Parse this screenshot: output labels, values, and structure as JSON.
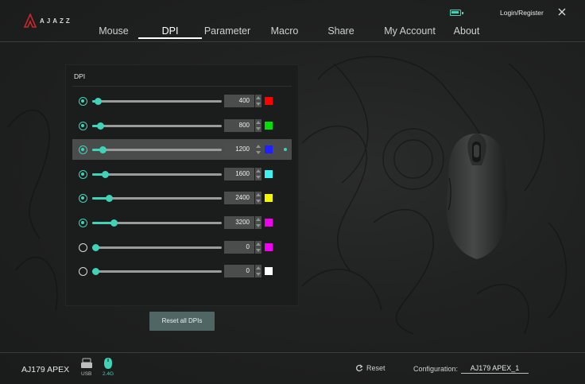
{
  "app": {
    "brand": "AJAZZ"
  },
  "header": {
    "nav": [
      {
        "label": "Mouse",
        "active": false
      },
      {
        "label": "DPI",
        "active": true
      },
      {
        "label": "Parameter",
        "active": false
      },
      {
        "label": "Macro",
        "active": false
      },
      {
        "label": "Share",
        "active": false
      },
      {
        "label": "My Account",
        "active": false
      },
      {
        "label": "About",
        "active": false
      }
    ],
    "login_label": "Login/Register",
    "battery_icon": "battery-icon",
    "close_icon": "close-icon"
  },
  "dpi_panel": {
    "title": "DPI",
    "levels": [
      {
        "value": "400",
        "color": "#ff0000",
        "checked": true,
        "fraction": 0.018
      },
      {
        "value": "800",
        "color": "#00e000",
        "checked": true,
        "fraction": 0.036
      },
      {
        "value": "1200",
        "color": "#1f1fff",
        "checked": true,
        "fraction": 0.054,
        "selected": true
      },
      {
        "value": "1600",
        "color": "#3ff0f0",
        "checked": true,
        "fraction": 0.071
      },
      {
        "value": "2400",
        "color": "#f5f500",
        "checked": true,
        "fraction": 0.107
      },
      {
        "value": "3200",
        "color": "#f000f0",
        "checked": true,
        "fraction": 0.143
      },
      {
        "value": "0",
        "color": "#f000f0",
        "checked": false,
        "fraction": 0.0
      },
      {
        "value": "0",
        "color": "#ffffff",
        "checked": false,
        "fraction": 0.0
      }
    ],
    "reset_label": "Reset all DPIs"
  },
  "footer": {
    "device_name": "AJ179 APEX",
    "usb_label": "USB",
    "rf_label": "2.4G",
    "reset_label": "Reset",
    "config_label": "Configuration:",
    "config_value": "AJ179 APEX_1"
  },
  "colors": {
    "accent": "#3fd3b7",
    "button": "#4f6664"
  }
}
